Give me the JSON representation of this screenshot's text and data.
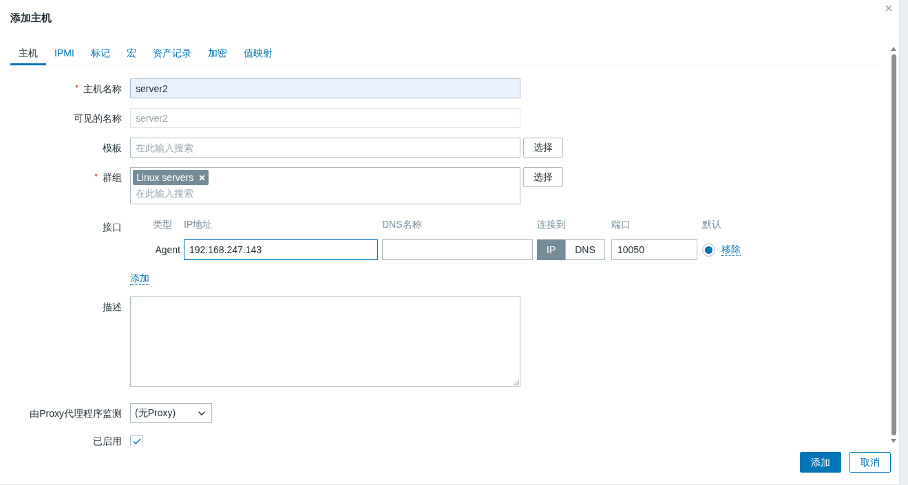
{
  "dialog": {
    "title": "添加主机"
  },
  "tabs": [
    {
      "label": "主机",
      "selected": true
    },
    {
      "label": "IPMI",
      "selected": false
    },
    {
      "label": "标记",
      "selected": false
    },
    {
      "label": "宏",
      "selected": false
    },
    {
      "label": "资产记录",
      "selected": false
    },
    {
      "label": "加密",
      "selected": false
    },
    {
      "label": "值映射",
      "selected": false
    }
  ],
  "host_name": {
    "label": "主机名称",
    "required": true,
    "value": "server2"
  },
  "visible_name": {
    "label": "可见的名称",
    "required": false,
    "placeholder": "server2"
  },
  "templates": {
    "label": "模板",
    "required": false,
    "placeholder": "在此输入搜索",
    "button": "选择"
  },
  "groups": {
    "label": "群组",
    "required": true,
    "tags": [
      {
        "label": "Linux servers"
      }
    ],
    "placeholder": "在此输入搜索",
    "button": "选择"
  },
  "interfaces": {
    "label": "接口",
    "columns": [
      "类型",
      "IP地址",
      "DNS名称",
      "连接到",
      "端口",
      "默认"
    ],
    "rows": [
      {
        "type": "Agent",
        "ip": "192.168.247.143",
        "connect_to": [
          {
            "label": "IP",
            "selected": true
          },
          {
            "label": "DNS",
            "selected": false
          }
        ],
        "port": "10050",
        "default": true,
        "remove": "移除"
      }
    ],
    "add": "添加"
  },
  "description": {
    "label": "描述"
  },
  "proxy": {
    "label": "由Proxy代理程序监测",
    "value": "(无Proxy)"
  },
  "enabled": {
    "label": "已启用",
    "checked": true
  },
  "footer_buttons": [
    {
      "label": "添加",
      "kind": "primary"
    },
    {
      "label": "取消",
      "kind": "secondary"
    }
  ]
}
